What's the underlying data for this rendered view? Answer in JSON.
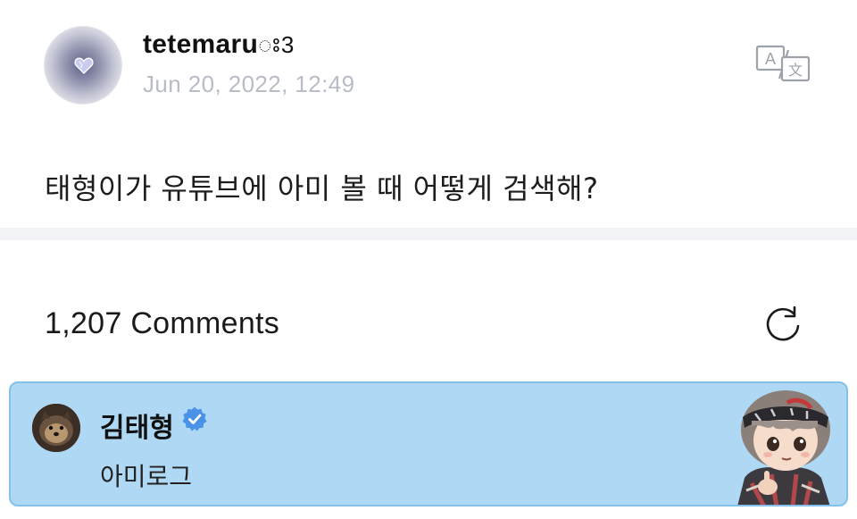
{
  "post": {
    "username": "tetemaru",
    "username_suffix": "ꢁ3",
    "timestamp": "Jun 20, 2022, 12:49",
    "body": "태형이가 유튜브에 아미 볼 때 어떻게 검색해?",
    "translate_icon": "translate-icon"
  },
  "comments": {
    "count_label": "1,207 Comments",
    "refresh_icon": "refresh-icon",
    "items": [
      {
        "author": "김태형",
        "verified": true,
        "text": "아미로그",
        "highlight_color": "#aed8f4"
      }
    ]
  }
}
